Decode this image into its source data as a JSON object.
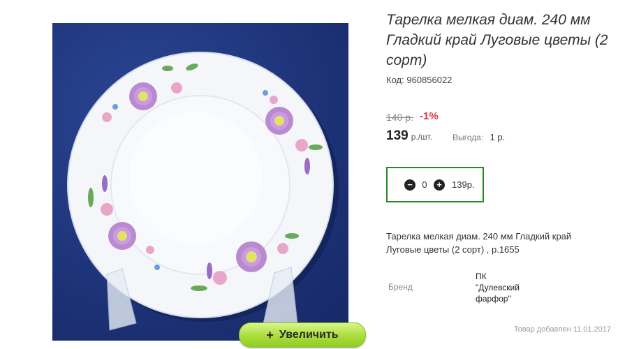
{
  "product": {
    "title": "Тарелка мелкая диам. 240 мм Гладкий край Луговые цветы (2 сорт)",
    "code_label": "Код:",
    "code_value": "960856022",
    "old_price": "140 р.",
    "discount": "-1%",
    "price": "139",
    "price_unit": "р./шт.",
    "benefit_label": "Выгода:",
    "benefit_value": "1 р.",
    "quantity": "0",
    "sum": "139р.",
    "description": "Тарелка мелкая диам. 240 мм Гладкий край Луговые цветы (2 сорт) , р.1655",
    "brand_label": "Бренд",
    "brand_value": "ПК\n\"Дулевский\nфарфор\"",
    "added_text": "Товар добавлен 11.01.2017"
  },
  "photo": {
    "zoom_label": "Увеличить",
    "zoom_icon": "plus-icon",
    "minus_icon": "minus-icon",
    "plus_icon": "plus-icon"
  },
  "colors": {
    "background_blue": "#1e3680",
    "zoom_green": "#a8dd3a",
    "qty_border_green": "#2a8a1f",
    "discount_red": "#e0324c"
  }
}
